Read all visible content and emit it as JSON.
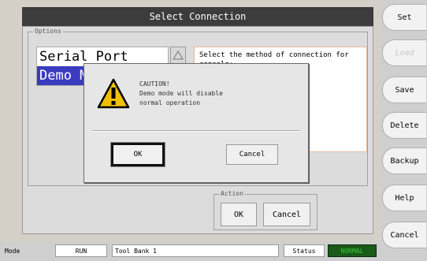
{
  "window": {
    "title": "Select Connection"
  },
  "options": {
    "label": "Options",
    "items": [
      {
        "label": "Serial Port",
        "selected": false
      },
      {
        "label": "Demo Mode",
        "selected": true
      }
    ],
    "description": "Select the method of connection for console:"
  },
  "action": {
    "label": "Action",
    "ok_label": "OK",
    "cancel_label": "Cancel"
  },
  "dialog": {
    "line1": "CAUTION!",
    "line2": "Demo mode will disable",
    "line3": "normal operation",
    "ok_label": "OK",
    "cancel_label": "Cancel",
    "icon": "warning-icon"
  },
  "sidebar": {
    "buttons": [
      {
        "label": "Set",
        "enabled": true
      },
      {
        "label": "Load",
        "enabled": false
      },
      {
        "label": "Save",
        "enabled": true
      },
      {
        "label": "Delete",
        "enabled": true
      },
      {
        "label": "Backup",
        "enabled": true
      },
      {
        "label": "Help",
        "enabled": true
      },
      {
        "label": "Cancel",
        "enabled": true
      }
    ]
  },
  "status_bar": {
    "mode_label": "Mode",
    "mode_value": "RUN",
    "tool_bank": "Tool Bank 1",
    "status_label": "Status",
    "status_value": "NORMAL"
  },
  "colors": {
    "title_bar": "#3c3c3c",
    "selection": "#3b3bc0",
    "status_normal_bg": "#1a5a1a",
    "status_normal_text": "#3cc83c",
    "warning_fill": "#f0c000"
  }
}
